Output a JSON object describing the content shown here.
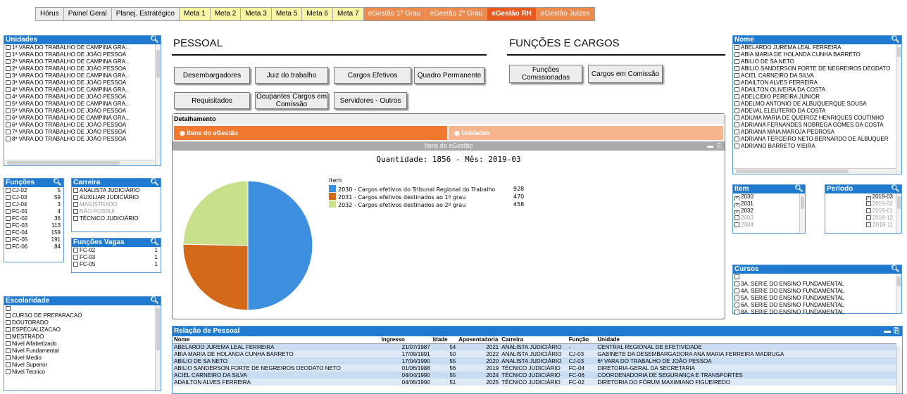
{
  "tabs": [
    {
      "label": "Hórus",
      "style": "gray"
    },
    {
      "label": "Painel Geral",
      "style": "gray"
    },
    {
      "label": "Planej. Estratégico",
      "style": "gray"
    },
    {
      "label": "Meta 1",
      "style": "yellow"
    },
    {
      "label": "Meta 2",
      "style": "yellow"
    },
    {
      "label": "Meta 3",
      "style": "yellow"
    },
    {
      "label": "Meta 5",
      "style": "yellow"
    },
    {
      "label": "Meta 6",
      "style": "yellow"
    },
    {
      "label": "Meta 7",
      "style": "yellow"
    },
    {
      "label": "eGestão 1º Grau",
      "style": "orange"
    },
    {
      "label": "eGestão 2º Grau",
      "style": "orange"
    },
    {
      "label": "eGestão RH",
      "style": "active"
    },
    {
      "label": "eGestão Juízes",
      "style": "orange"
    }
  ],
  "unidades": {
    "title": "Unidades",
    "items": [
      "1ª VARA DO TRABALHO DE CAMPINA GRA...",
      "1ª VARA DO TRABALHO DE JOÃO PESSOA",
      "2ª VARA DO TRABALHO DE CAMPINA GRA...",
      "2ª VARA DO TRABALHO DE JOÃO PESSOA",
      "3ª VARA DO TRABALHO DE CAMPINA GRA...",
      "3ª VARA DO TRABALHO DE JOÃO PESSOA",
      "4ª VARA DO TRABALHO DE CAMPINA GRA...",
      "4ª VARA DO TRABALHO DE JOÃO PESSOA",
      "5ª VARA DO TRABALHO DE CAMPINA GRA...",
      "5ª VARA DO TRABALHO DE JOÃO PESSOA",
      "6ª VARA DO TRABALHO DE CAMPINA GRA...",
      "6ª VARA DO TRABALHO DE JOÃO PESSOA",
      "7ª VARA DO TRABALHO DE JOÃO PESSOA",
      "8ª VARA DO TRABALHO DE JOÃO PESSOA"
    ]
  },
  "funcoes": {
    "title": "Funções",
    "items": [
      {
        "label": "CJ-02",
        "count": "5"
      },
      {
        "label": "CJ-03",
        "count": "59"
      },
      {
        "label": "CJ-04",
        "count": "3"
      },
      {
        "label": "FC-01",
        "count": "4"
      },
      {
        "label": "FC-02",
        "count": "36"
      },
      {
        "label": "FC-03",
        "count": "113"
      },
      {
        "label": "FC-04",
        "count": "159"
      },
      {
        "label": "FC-05",
        "count": "191"
      },
      {
        "label": "FC-06",
        "count": "84"
      }
    ]
  },
  "carreira": {
    "title": "Carreira",
    "items": [
      {
        "label": "ANALISTA JUDICIÁRIO",
        "grey": false
      },
      {
        "label": "AUXILIAR JUDICIÁRIO",
        "grey": false
      },
      {
        "label": "MAGISTRADO",
        "grey": true
      },
      {
        "label": "NÃO POSSUI",
        "grey": true
      },
      {
        "label": "TÉCNICO JUDICIÁRIO",
        "grey": false
      }
    ]
  },
  "funcoes_vagas": {
    "title": "Funções Vagas",
    "items": [
      {
        "label": "FC-02",
        "count": "1"
      },
      {
        "label": "FC-03",
        "count": "1"
      },
      {
        "label": "FC-05",
        "count": "1"
      }
    ]
  },
  "escolaridade": {
    "title": "Escolaridade",
    "items": [
      "",
      "CURSO DE PREPARACAO",
      "DOUTORADO",
      "ESPECIALIZACAO",
      "MESTRADO",
      "Nivel Alfabetizado",
      "Nivel Fundamental",
      "Nivel Medio",
      "Nivel Superior",
      "Nivel Tecnico"
    ]
  },
  "pessoal": {
    "title": "PESSOAL",
    "buttons": [
      "Desembargadores",
      "Juiz do trabalho",
      "Cargos Efetivos",
      "Quadro Permanente",
      "Requisitados",
      "Ocupantes Cargos em Comissão",
      "Servidores - Outros"
    ]
  },
  "funcoes_cargos": {
    "title": "FUNÇÕES E CARGOS",
    "buttons": [
      "Funções Comissionadas",
      "Cargos em Comissão"
    ]
  },
  "detalhamento": {
    "title": "Detalhamento",
    "tab_itens": "Itens do eGestão",
    "tab_unidades": "Unidades",
    "chart_caption": "Itens do eGestão",
    "quantity_text": "Quantidade: 1856 - Mês: 2019-03",
    "legend_title": "Item"
  },
  "chart_data": {
    "type": "pie",
    "title": "Quantidade: 1856 - Mês: 2019-03",
    "legend_title": "Item",
    "series": [
      {
        "name": "2030 - Cargos efetivos do Tribunal Regional do Trabalho",
        "value": 928,
        "color": "#3d8fe0"
      },
      {
        "name": "2031 - Cargos efetivos destinados ao 1º grau",
        "value": 470,
        "color": "#d4691a"
      },
      {
        "name": "2032 - Cargos efetivos destinados ao 2º grau",
        "value": 458,
        "color": "#c8e08a"
      }
    ]
  },
  "nome": {
    "title": "Nome",
    "items": [
      "ABELARDO JUREMA LEAL FERREIRA",
      "ABIA MARIA DE HOLANDA CUNHA BARRETO",
      "ABILIO DE SA NETO",
      "ABILIO SANDERSON FORTE DE NEGREIROS DEODATO",
      "ACIEL CARNEIRO DA SILVA",
      "ADAILTON ALVES FERREIRA",
      "ADAILTON OLIVEIRA DA COSTA",
      "ADELCIDIO PEREIRA JUNIOR",
      "ADELMO ANTONIO DE ALBUQUERQUE SOUSA",
      "ADEVAL ELEUTERIO DA COSTA",
      "ADILMA MARIA DE QUEIROZ HENRIQUES COUTINHO",
      "ADRIANA FERNANDES NOBREGA GOMES DA COSTA",
      "ADRIANA MAIA MAROJA PEDROSA",
      "ADRIANA TERCEIRO NETO BERNARDO DE ALBUQUER",
      "ADRIANO BARRETO VIEIRA"
    ]
  },
  "item_filter": {
    "title": "Item",
    "items": [
      {
        "label": "2030",
        "checked": true,
        "grey": false
      },
      {
        "label": "2031",
        "checked": true,
        "grey": false
      },
      {
        "label": "2032",
        "checked": true,
        "grey": false
      },
      {
        "label": "2003",
        "checked": false,
        "grey": true
      },
      {
        "label": "2004",
        "checked": false,
        "grey": true
      }
    ]
  },
  "periodo": {
    "title": "Período",
    "items": [
      {
        "label": "2019-03",
        "checked": true,
        "grey": false
      },
      {
        "label": "2019-02",
        "checked": false,
        "grey": true
      },
      {
        "label": "2019-01",
        "checked": false,
        "grey": true
      },
      {
        "label": "2018-12",
        "checked": false,
        "grey": true
      },
      {
        "label": "2018-11",
        "checked": false,
        "grey": true
      }
    ]
  },
  "cursos": {
    "title": "Cursos",
    "items": [
      "",
      "3A. SERIE DO ENSINO FUNDAMENTAL",
      "4A. SERIE DO ENSINO FUNDAMENTAL",
      "5A. SERIE DO ENSINO FUNDAMENTAL",
      "6A. SERIE DO ENSINO FUNDAMENTAL",
      "8A. SERIE DO ENSINO FUNDAMENTAL"
    ]
  },
  "relacao": {
    "title": "Relação de Pessoal",
    "columns": [
      "Nome",
      "Ingresso",
      "Idade",
      "Aposentadoria",
      "Carreira",
      "Função",
      "Unidade"
    ],
    "rows": [
      [
        "ABELARDO JUREMA LEAL FERREIRA",
        "21/07/1987",
        "54",
        "2021",
        "ANALISTA JUDICIÁRIO",
        "-",
        "CENTRAL REGIONAL DE EFETIVIDADE"
      ],
      [
        "ABIA MARIA DE HOLANDA CUNHA BARRETO",
        "17/09/1991",
        "50",
        "2022",
        "ANALISTA JUDICIÁRIO",
        "CJ-03",
        "GABINETE DA DESEMBARGADORA ANA MARIA FERREIRA MADRUGA"
      ],
      [
        "ABILIO DE SA NETO",
        "17/04/1990",
        "55",
        "2020",
        "ANALISTA JUDICIÁRIO",
        "CJ-03",
        "6ª VARA DO TRABALHO DE JOÃO PESSOA"
      ],
      [
        "ABILIO SANDERSON FORTE DE NEGREIROS DEODATO NETO",
        "01/06/1988",
        "56",
        "2019",
        "TÉCNICO JUDICIÁRIO",
        "FC-04",
        "DIRETORIA-GERAL DA SECRETARIA"
      ],
      [
        "ACIEL CARNEIRO DA SILVA",
        "04/04/1990",
        "55",
        "2024",
        "TÉCNICO JUDICIÁRIO",
        "FC-06",
        "COORDENADORIA DE SEGURANÇA E TRANSPORTES"
      ],
      [
        "ADAILTON ALVES FERREIRA",
        "04/06/1990",
        "51",
        "2025",
        "TÉCNICO JUDICIÁRIO",
        "FC-02",
        "DIRETORIA DO FÓRUM MAXIMIANO FIGUEIREDO"
      ]
    ]
  }
}
